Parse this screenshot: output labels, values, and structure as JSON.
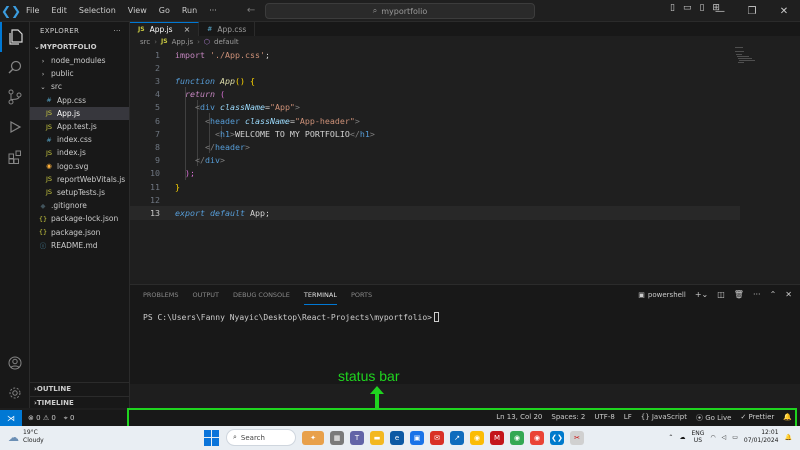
{
  "titlebar": {
    "menu": [
      "File",
      "Edit",
      "Selection",
      "View",
      "Go",
      "Run",
      "···"
    ],
    "command_center": "myportfolio"
  },
  "sidebar": {
    "header": "EXPLORER",
    "project": "MYPORTFOLIO",
    "items": [
      {
        "label": "node_modules",
        "icon": "chevron-right",
        "depth": 1
      },
      {
        "label": "public",
        "icon": "chevron-right",
        "depth": 1
      },
      {
        "label": "src",
        "icon": "chevron-down",
        "depth": 1
      },
      {
        "label": "App.css",
        "icon": "#",
        "depth": 2
      },
      {
        "label": "App.js",
        "icon": "JS",
        "depth": 2,
        "selected": true
      },
      {
        "label": "App.test.js",
        "icon": "JS",
        "depth": 2
      },
      {
        "label": "index.css",
        "icon": "#",
        "depth": 2
      },
      {
        "label": "index.js",
        "icon": "JS",
        "depth": 2
      },
      {
        "label": "logo.svg",
        "icon": "svg",
        "depth": 2
      },
      {
        "label": "reportWebVitals.js",
        "icon": "JS",
        "depth": 2
      },
      {
        "label": "setupTests.js",
        "icon": "JS",
        "depth": 2
      },
      {
        "label": ".gitignore",
        "icon": "git",
        "depth": 1
      },
      {
        "label": "package-lock.json",
        "icon": "{}",
        "depth": 1
      },
      {
        "label": "package.json",
        "icon": "{}",
        "depth": 1
      },
      {
        "label": "README.md",
        "icon": "info",
        "depth": 1
      }
    ],
    "outline": "OUTLINE",
    "timeline": "TIMELINE"
  },
  "tabs": [
    {
      "label": "App.js",
      "icon": "JS",
      "active": true
    },
    {
      "label": "App.css",
      "icon": "#",
      "active": false
    }
  ],
  "breadcrumb": {
    "parts": [
      "src",
      "App.js",
      "default"
    ]
  },
  "editor": {
    "lines": [
      {
        "n": "1"
      },
      {
        "n": "2"
      },
      {
        "n": "3"
      },
      {
        "n": "4"
      },
      {
        "n": "5"
      },
      {
        "n": "6"
      },
      {
        "n": "7"
      },
      {
        "n": "8"
      },
      {
        "n": "9"
      },
      {
        "n": "10"
      },
      {
        "n": "11"
      },
      {
        "n": "12"
      },
      {
        "n": "13"
      }
    ],
    "code": {
      "l1_kw": "import",
      "l1_str": "'./App.css'",
      "l1_end": ";",
      "l3_kw": "function",
      "l3_fn": "App",
      "l3_rest": "() {",
      "l4_kw": "return",
      "l4_rest": " (",
      "l5_open": "<",
      "l5_tag": "div",
      "l5_attr": "className",
      "l5_eq": "=",
      "l5_str": "\"App\"",
      "l5_close": ">",
      "l6_open": "<",
      "l6_tag": "header",
      "l6_attr": "className",
      "l6_eq": "=",
      "l6_str": "\"App-header\"",
      "l6_close": ">",
      "l7_open": "<",
      "l7_tag": "h1",
      "l7_close": ">",
      "l7_text": "WELCOME TO MY PORTFOLIO",
      "l7_endopen": "</",
      "l7_endtag": "h1",
      "l7_endclose": ">",
      "l8_open": "</",
      "l8_tag": "header",
      "l8_close": ">",
      "l9_open": "</",
      "l9_tag": "div",
      "l9_close": ">",
      "l10": ");",
      "l11": "}",
      "l13_kw": "export",
      "l13_kw2": "default",
      "l13_ident": "App",
      "l13_end": ";"
    }
  },
  "panel": {
    "tabs": [
      "PROBLEMS",
      "OUTPUT",
      "DEBUG CONSOLE",
      "TERMINAL",
      "PORTS"
    ],
    "active_tab": "TERMINAL",
    "shell": "powershell",
    "prompt": "PS C:\\Users\\Fanny Nyayic\\Desktop\\React-Projects\\myportfolio>"
  },
  "annotation": {
    "label": "status bar",
    "color": "#1fd41f"
  },
  "statusbar": {
    "problems": "0",
    "warnings": "0",
    "ports": "0",
    "right": [
      "Ln 13, Col 20",
      "Spaces: 2",
      "UTF-8",
      "LF",
      "{} JavaScript",
      "Go Live",
      "✓ Prettier"
    ]
  },
  "taskbar": {
    "weather_temp": "19°C",
    "weather_desc": "Cloudy",
    "search": "Search",
    "lang_1": "ENG",
    "lang_2": "US",
    "time": "12:01",
    "date": "07/01/2024"
  },
  "colors": {
    "accent": "#0078d4",
    "annotation": "#1fd41f",
    "editor_bg": "#1f1f1f"
  }
}
